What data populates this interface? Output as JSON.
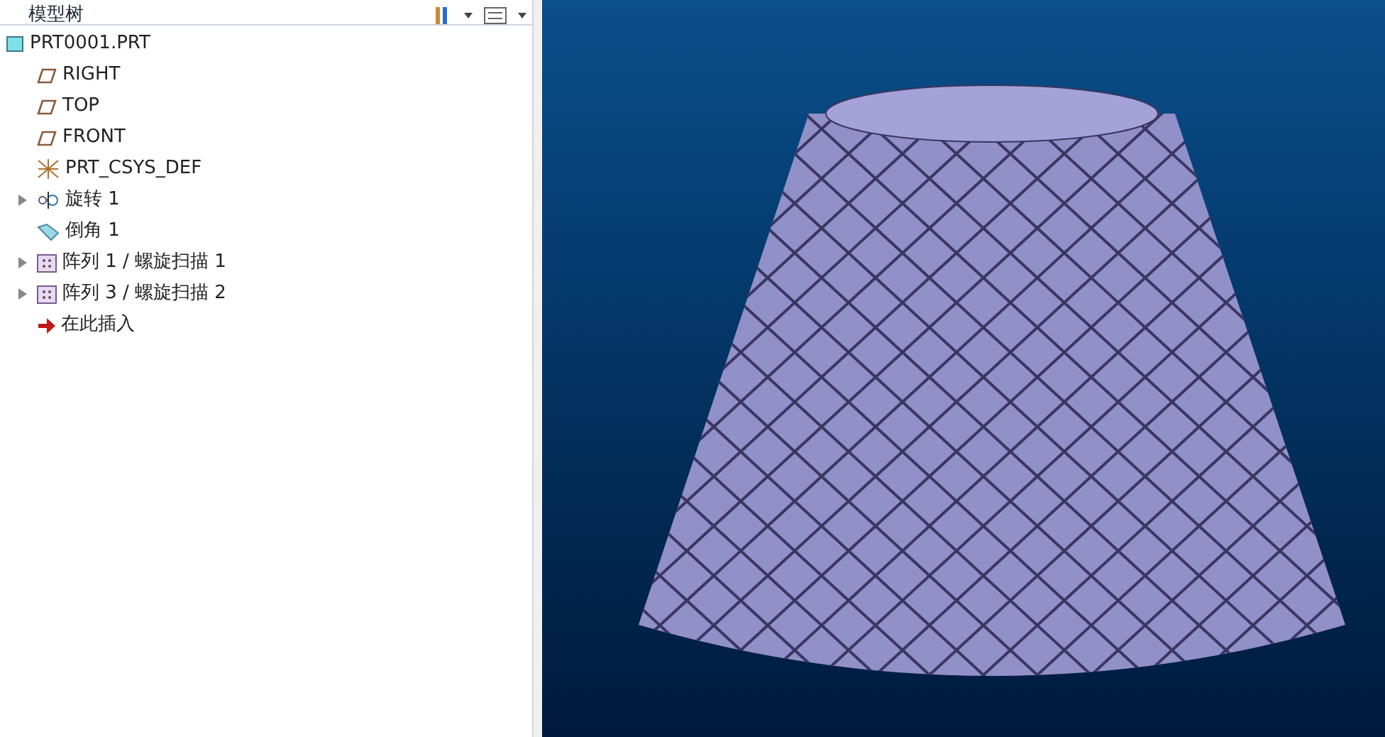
{
  "panel": {
    "title": "模型树"
  },
  "tree": [
    {
      "label": "PRT0001.PRT",
      "kind": "part",
      "children": [
        {
          "label": "RIGHT",
          "kind": "plane"
        },
        {
          "label": "TOP",
          "kind": "plane"
        },
        {
          "label": "FRONT",
          "kind": "plane"
        },
        {
          "label": "PRT_CSYS_DEF",
          "kind": "csys"
        },
        {
          "label": "旋转 1",
          "kind": "revolve",
          "expanded": false
        },
        {
          "label": "倒角 1",
          "kind": "chamfer"
        },
        {
          "label": "阵列 1 / 螺旋扫描 1",
          "kind": "pattern",
          "expanded": false
        },
        {
          "label": "阵列 3 / 螺旋扫描 2",
          "kind": "pattern",
          "expanded": false
        },
        {
          "label": "在此插入",
          "kind": "insert"
        }
      ]
    }
  ]
}
